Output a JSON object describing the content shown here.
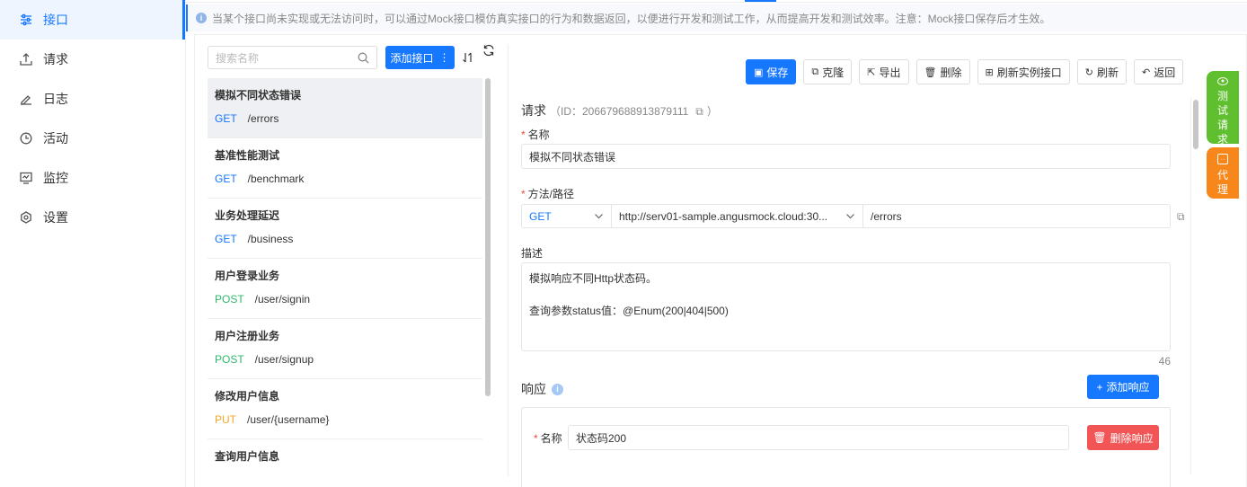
{
  "sidebar": {
    "items": [
      {
        "label": "接口",
        "icon": "sliders-icon",
        "active": true
      },
      {
        "label": "请求",
        "icon": "upload-icon"
      },
      {
        "label": "日志",
        "icon": "pen-icon"
      },
      {
        "label": "活动",
        "icon": "clock-icon"
      },
      {
        "label": "监控",
        "icon": "monitor-icon"
      },
      {
        "label": "设置",
        "icon": "settings-icon"
      }
    ]
  },
  "notice": "当某个接口尚未实现或无法访问时，可以通过Mock接口模仿真实接口的行为和数据返回，以便进行开发和测试工作，从而提高开发和测试效率。注意：Mock接口保存后才生效。",
  "list_panel": {
    "search_placeholder": "搜索名称",
    "add_button": "添加接口",
    "items": [
      {
        "name": "模拟不同状态错误",
        "method": "GET",
        "path": "/errors"
      },
      {
        "name": "基准性能测试",
        "method": "GET",
        "path": "/benchmark"
      },
      {
        "name": "业务处理延迟",
        "method": "GET",
        "path": "/business"
      },
      {
        "name": "用户登录业务",
        "method": "POST",
        "path": "/user/signin"
      },
      {
        "name": "用户注册业务",
        "method": "POST",
        "path": "/user/signup"
      },
      {
        "name": "修改用户信息",
        "method": "PUT",
        "path": "/user/{username}"
      },
      {
        "name": "查询用户信息",
        "method": "",
        "path": ""
      }
    ]
  },
  "toolbar": {
    "save": "保存",
    "clone": "克隆",
    "export": "导出",
    "delete": "删除",
    "refresh_instance": "刷新实例接口",
    "refresh": "刷新",
    "back": "返回"
  },
  "request": {
    "title": "请求",
    "id_text": "（ID：206679688913879111",
    "id_close": "）",
    "name_label": "名称",
    "name_value": "模拟不同状态错误",
    "method_path_label": "方法/路径",
    "method": "GET",
    "server": "http://serv01-sample.angusmock.cloud:30...",
    "path": "/errors",
    "desc_label": "描述",
    "desc_line1": "模拟响应不同Http状态码。",
    "desc_line2": "",
    "desc_line3": "查询参数status值：@Enum(200|404|500)",
    "desc_count": "46"
  },
  "response": {
    "title": "响应",
    "add_button": "添加响应",
    "name_label": "名称",
    "name_value": "状态码200",
    "delete_button": "删除响应"
  },
  "side_tabs": {
    "test": [
      "测",
      "试",
      "请",
      "求"
    ],
    "proxy": [
      "代",
      "理"
    ]
  }
}
